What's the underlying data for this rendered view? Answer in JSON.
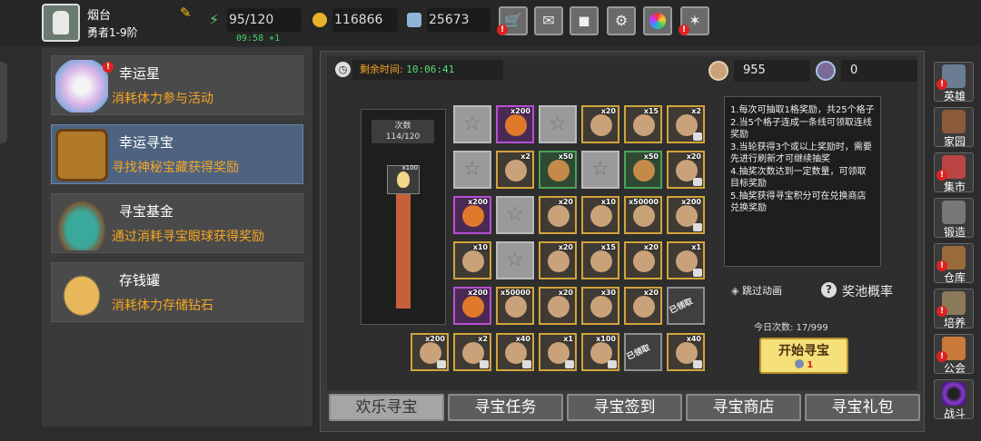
{
  "player": {
    "name": "烟台",
    "rank": "勇者1-9阶"
  },
  "resources": {
    "energy": "95/120",
    "energy_timer": "09:58 +1",
    "coins": "116866",
    "gems": "25673"
  },
  "left_menu": [
    {
      "title": "幸运星",
      "desc": "消耗体力参与活动",
      "badge": "!"
    },
    {
      "title": "幸运寻宝",
      "desc": "寻找神秘宝藏获得奖励"
    },
    {
      "title": "寻宝基金",
      "desc": "通过消耗寻宝眼球获得奖励"
    },
    {
      "title": "存钱罐",
      "desc": "消耗体力存储钻石"
    }
  ],
  "event": {
    "time_label": "剩余时间:",
    "time_value": "10:06:41",
    "eyeball_count": "955",
    "points": "0"
  },
  "counter": {
    "label": "次数",
    "value": "114/120",
    "cap_qty": "x100"
  },
  "grid_rows": [
    [
      {
        "t": "empty"
      },
      {
        "t": "purple",
        "q": "x200"
      },
      {
        "t": "empty"
      },
      {
        "t": "gold",
        "q": "x20"
      },
      {
        "t": "gold",
        "q": "x15"
      },
      {
        "t": "gold",
        "q": "x2",
        "lock": true
      }
    ],
    [
      {
        "t": "empty"
      },
      {
        "t": "gold",
        "q": "x2"
      },
      {
        "t": "green",
        "q": "x50"
      },
      {
        "t": "empty"
      },
      {
        "t": "green",
        "q": "x50"
      },
      {
        "t": "gold",
        "q": "x20",
        "lock": true
      }
    ],
    [
      {
        "t": "purple",
        "q": "x200"
      },
      {
        "t": "empty"
      },
      {
        "t": "gold",
        "q": "x20"
      },
      {
        "t": "gold",
        "q": "x10"
      },
      {
        "t": "gold",
        "q": "x50000"
      },
      {
        "t": "gold",
        "q": "x200",
        "lock": true
      }
    ],
    [
      {
        "t": "gold",
        "q": "x10"
      },
      {
        "t": "empty"
      },
      {
        "t": "gold",
        "q": "x20"
      },
      {
        "t": "gold",
        "q": "x15"
      },
      {
        "t": "gold",
        "q": "x20"
      },
      {
        "t": "gold",
        "q": "x1",
        "lock": true
      }
    ],
    [
      {
        "t": "purple",
        "q": "x200"
      },
      {
        "t": "gold",
        "q": "x50000"
      },
      {
        "t": "gold",
        "q": "x20"
      },
      {
        "t": "gold",
        "q": "x30"
      },
      {
        "t": "gold",
        "q": "x20"
      },
      {
        "t": "gray",
        "stamp": "已领取"
      }
    ]
  ],
  "bottom_row": [
    {
      "t": "gold",
      "q": "x200",
      "lock": true
    },
    {
      "t": "gold",
      "q": "x2",
      "lock": true
    },
    {
      "t": "gold",
      "q": "x40",
      "lock": true
    },
    {
      "t": "gold",
      "q": "x1",
      "lock": true
    },
    {
      "t": "gold",
      "q": "x100",
      "lock": true
    },
    {
      "t": "gray",
      "stamp": "已领取"
    },
    {
      "t": "gold",
      "q": "x40",
      "lock": true
    }
  ],
  "rules": [
    "1.每次可抽取1格奖励，共25个格子",
    "2.当5个格子连成一条线可领取连线奖励",
    "3.当轮获得3个或以上奖励时，需要先进行刷新才可继续抽奖",
    "4.抽奖次数达到一定数量，可领取目标奖励",
    "5.抽奖获得寻宝积分可在兑换商店兑换奖励"
  ],
  "skip_label": "跳过动画",
  "rate_label": "奖池概率",
  "today_count": "今日次数: 17/999",
  "start_button": {
    "label": "开始寻宝",
    "cost": "1"
  },
  "tabs": [
    "欢乐寻宝",
    "寻宝任务",
    "寻宝签到",
    "寻宝商店",
    "寻宝礼包"
  ],
  "side_menu": [
    "英雄",
    "家园",
    "集市",
    "锻造",
    "仓库",
    "培养",
    "公会",
    "战斗"
  ],
  "colors": {
    "accent_orange": "#f5a623",
    "timer_green": "#49d36d",
    "selected_card": "#4d6380"
  }
}
